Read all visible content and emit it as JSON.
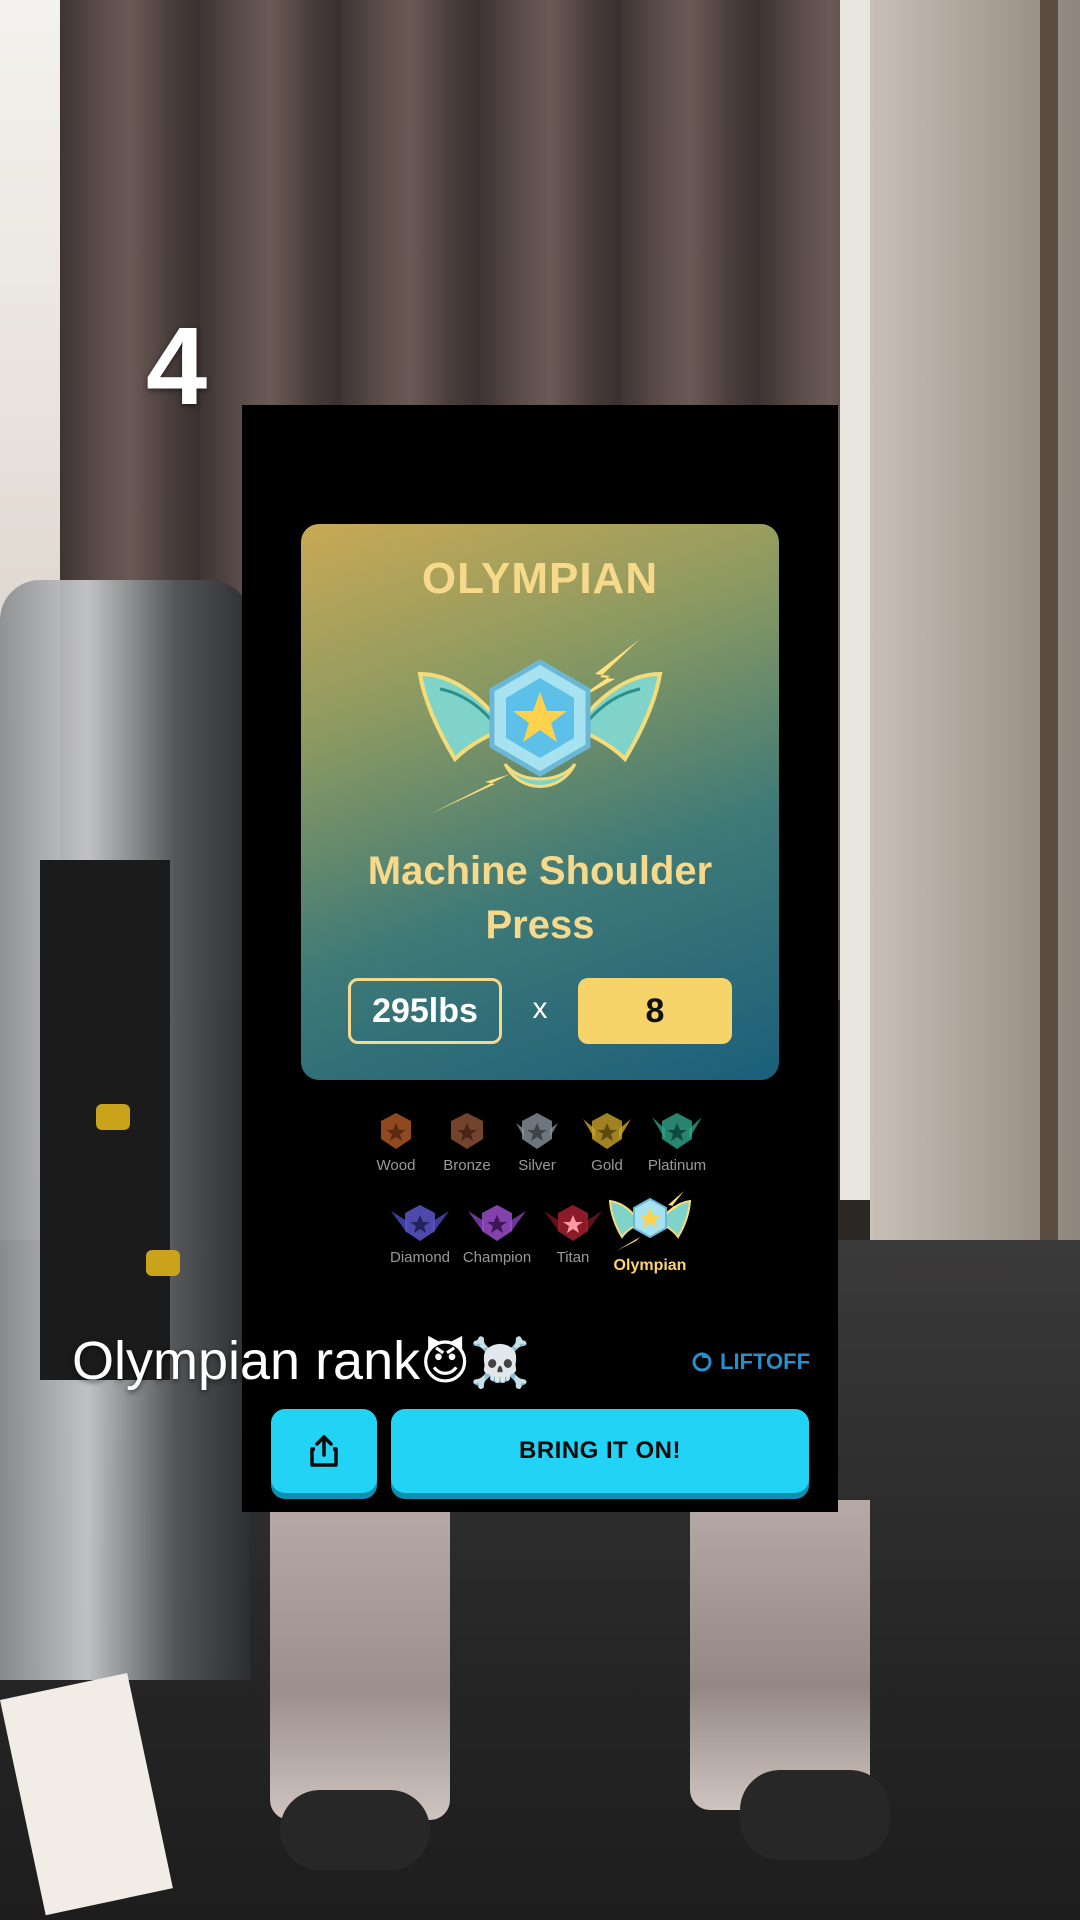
{
  "overlay": {
    "step_number": "4",
    "caption_text": "Olympian rank",
    "caption_emojis": "😈☠️"
  },
  "card": {
    "rank_title": "OLYMPIAN",
    "exercise": "Machine Shoulder Press",
    "weight": "295lbs",
    "times_symbol": "x",
    "reps": "8"
  },
  "tiers": [
    {
      "label": "Wood",
      "color": "#c0622a"
    },
    {
      "label": "Bronze",
      "color": "#9b5a3c"
    },
    {
      "label": "Silver",
      "color": "#8a949c"
    },
    {
      "label": "Gold",
      "color": "#c9a32c"
    },
    {
      "label": "Platinum",
      "color": "#2fa58b"
    },
    {
      "label": "Diamond",
      "color": "#5b57c9"
    },
    {
      "label": "Champion",
      "color": "#9a4cc9"
    },
    {
      "label": "Titan",
      "color": "#a3202f"
    },
    {
      "label": "Olympian",
      "color": "#7fd6ee",
      "active": true
    }
  ],
  "brand": {
    "name": "LIFTOFF"
  },
  "buttons": {
    "share_icon": "share-icon",
    "cta_label": "BRING IT ON!"
  },
  "colors": {
    "accent": "#22d3f5",
    "gold_text": "#f6d98a",
    "reps_fill": "#f6d46a"
  }
}
